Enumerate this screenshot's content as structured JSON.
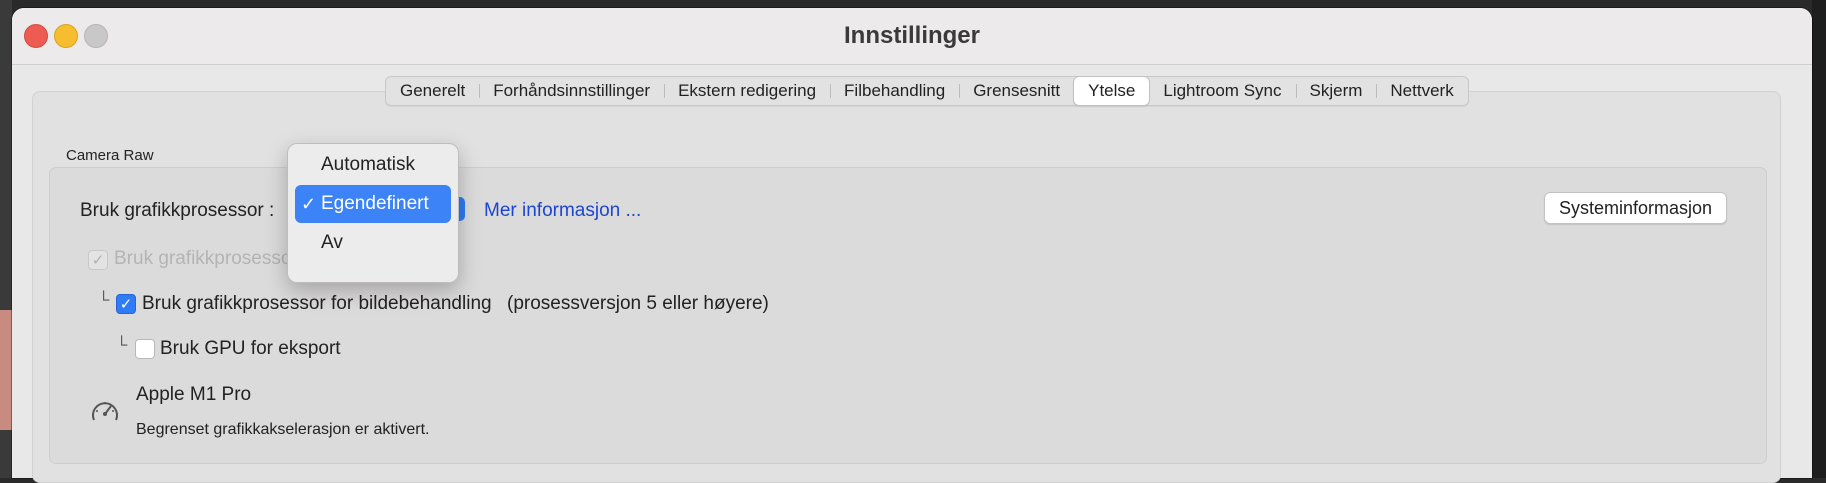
{
  "window": {
    "title": "Innstillinger"
  },
  "tabs": [
    {
      "label": "Generelt"
    },
    {
      "label": "Forhåndsinnstillinger"
    },
    {
      "label": "Ekstern redigering"
    },
    {
      "label": "Filbehandling"
    },
    {
      "label": "Grensesnitt"
    },
    {
      "label": "Ytelse",
      "active": true
    },
    {
      "label": "Lightroom Sync"
    },
    {
      "label": "Skjerm"
    },
    {
      "label": "Nettverk"
    }
  ],
  "camera_raw": {
    "section_label": "Camera Raw",
    "gpu_label": "Bruk grafikkprosessor :",
    "more_info": "Mer informasjon ...",
    "sysinfo_button": "Systeminformasjon",
    "disabled_option": "Bruk grafikkprosessor",
    "tree_glyph": "└",
    "processing_option": "Bruk grafikkprosessor for bildebehandling",
    "processing_note": "(prosessversjon 5 eller høyere)",
    "export_option": "Bruk GPU for eksport",
    "gpu_name": "Apple M1 Pro",
    "gpu_status": "Begrenset grafikkakselerasjon er aktivert."
  },
  "dropdown": {
    "items": [
      "Automatisk",
      "Egendefinert",
      "Av"
    ],
    "selected": "Egendefinert",
    "check_mark": "✓"
  },
  "colors": {
    "accent": "#2f7cf6",
    "link": "#1d46cf",
    "close": "#ee5b53",
    "minimize": "#f6be2f"
  }
}
